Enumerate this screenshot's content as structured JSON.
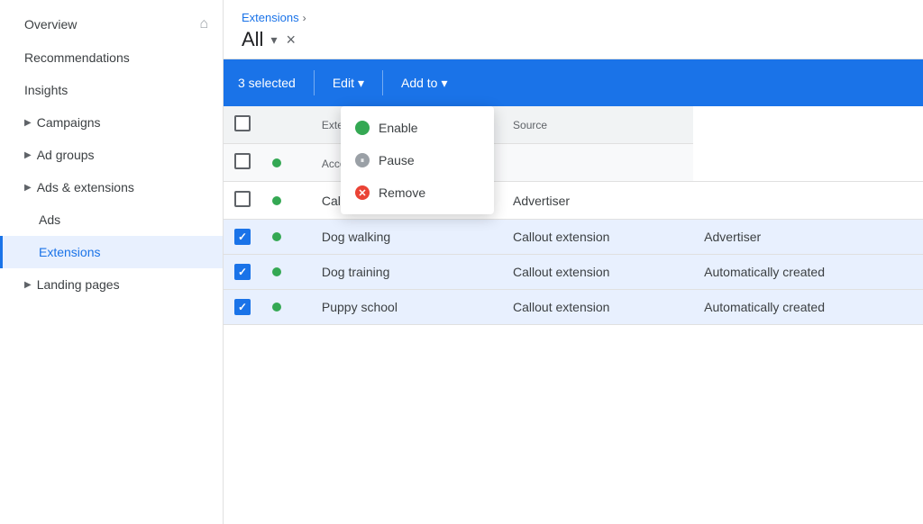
{
  "sidebar": {
    "items": [
      {
        "id": "overview",
        "label": "Overview",
        "hasHome": true,
        "indent": false,
        "active": false
      },
      {
        "id": "recommendations",
        "label": "Recommendations",
        "hasHome": false,
        "indent": false,
        "active": false
      },
      {
        "id": "insights",
        "label": "Insights",
        "hasHome": false,
        "indent": false,
        "active": false
      },
      {
        "id": "campaigns",
        "label": "Campaigns",
        "hasArrow": true,
        "indent": false,
        "active": false
      },
      {
        "id": "ad-groups",
        "label": "Ad groups",
        "hasArrow": true,
        "indent": false,
        "active": false
      },
      {
        "id": "ads-extensions",
        "label": "Ads & extensions",
        "hasArrow": true,
        "indent": false,
        "active": false
      },
      {
        "id": "ads",
        "label": "Ads",
        "indent": true,
        "active": false
      },
      {
        "id": "extensions",
        "label": "Extensions",
        "indent": true,
        "active": true
      },
      {
        "id": "landing-pages",
        "label": "Landing pages",
        "hasArrow": true,
        "indent": false,
        "active": false
      }
    ]
  },
  "breadcrumb": {
    "text": "Extensions",
    "chevron": "›"
  },
  "header": {
    "title": "All",
    "close_label": "×"
  },
  "toolbar": {
    "selected_label": "3 selected",
    "edit_label": "Edit",
    "add_to_label": "Add to"
  },
  "dropdown_menu": {
    "items": [
      {
        "id": "enable",
        "label": "Enable",
        "icon": "dot-green"
      },
      {
        "id": "pause",
        "label": "Pause",
        "icon": "dot-pause"
      },
      {
        "id": "remove",
        "label": "Remove",
        "icon": "dot-remove"
      }
    ]
  },
  "table": {
    "headers": [
      "",
      "",
      "Extension type",
      "Source"
    ],
    "rows": [
      {
        "checked": false,
        "status": true,
        "name": "Account",
        "ext_type": "",
        "source": "",
        "is_account": true,
        "selected": false
      },
      {
        "checked": false,
        "status": true,
        "name": "",
        "ext_type": "Callout extension",
        "source": "Advertiser",
        "is_account": false,
        "selected": false
      },
      {
        "checked": true,
        "status": true,
        "name": "Dog walking",
        "ext_type": "Callout extension",
        "source": "Advertiser",
        "is_account": false,
        "selected": true
      },
      {
        "checked": true,
        "status": true,
        "name": "Dog training",
        "ext_type": "Callout extension",
        "source": "Automatically created",
        "is_account": false,
        "selected": true
      },
      {
        "checked": true,
        "status": true,
        "name": "Puppy school",
        "ext_type": "Callout extension",
        "source": "Automatically created",
        "is_account": false,
        "selected": true
      }
    ]
  },
  "colors": {
    "blue": "#1a73e8",
    "green": "#34a853",
    "red": "#ea4335",
    "gray": "#9aa0a6"
  }
}
